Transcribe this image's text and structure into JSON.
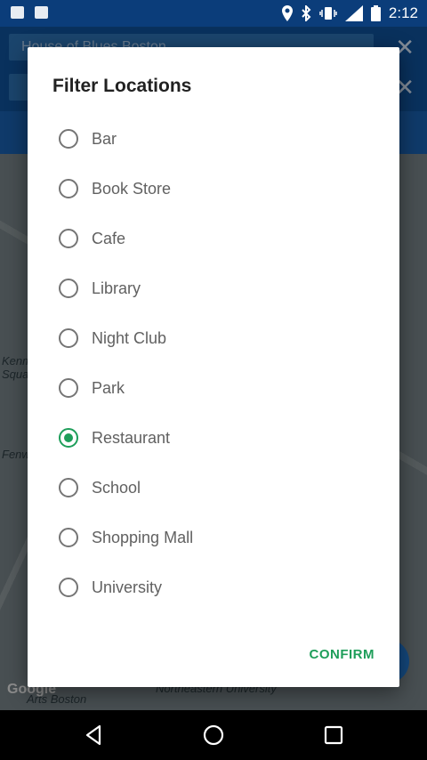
{
  "status_bar": {
    "time": "2:12",
    "icons": [
      "outlook-icon",
      "image-icon",
      "location-icon",
      "bluetooth-icon",
      "vibrate-icon",
      "lte-signal-icon",
      "battery-icon"
    ]
  },
  "dialog": {
    "title": "Filter Locations",
    "options": [
      {
        "label": "Bar",
        "selected": false
      },
      {
        "label": "Book Store",
        "selected": false
      },
      {
        "label": "Cafe",
        "selected": false
      },
      {
        "label": "Library",
        "selected": false
      },
      {
        "label": "Night Club",
        "selected": false
      },
      {
        "label": "Park",
        "selected": false
      },
      {
        "label": "Restaurant",
        "selected": true
      },
      {
        "label": "School",
        "selected": false
      },
      {
        "label": "Shopping Mall",
        "selected": false
      },
      {
        "label": "University",
        "selected": false
      }
    ],
    "confirm_label": "CONFIRM"
  },
  "background": {
    "search_field_1": "House of Blues Boston",
    "map_labels": [
      "Fenway",
      "Kenmore Square",
      "Northeastern University",
      "Arts Boston"
    ],
    "google_logo": "Google"
  },
  "colors": {
    "accent": "#1e9e5a",
    "app_bar": "#0e4c8f",
    "status_bar": "#0b3d7a"
  }
}
